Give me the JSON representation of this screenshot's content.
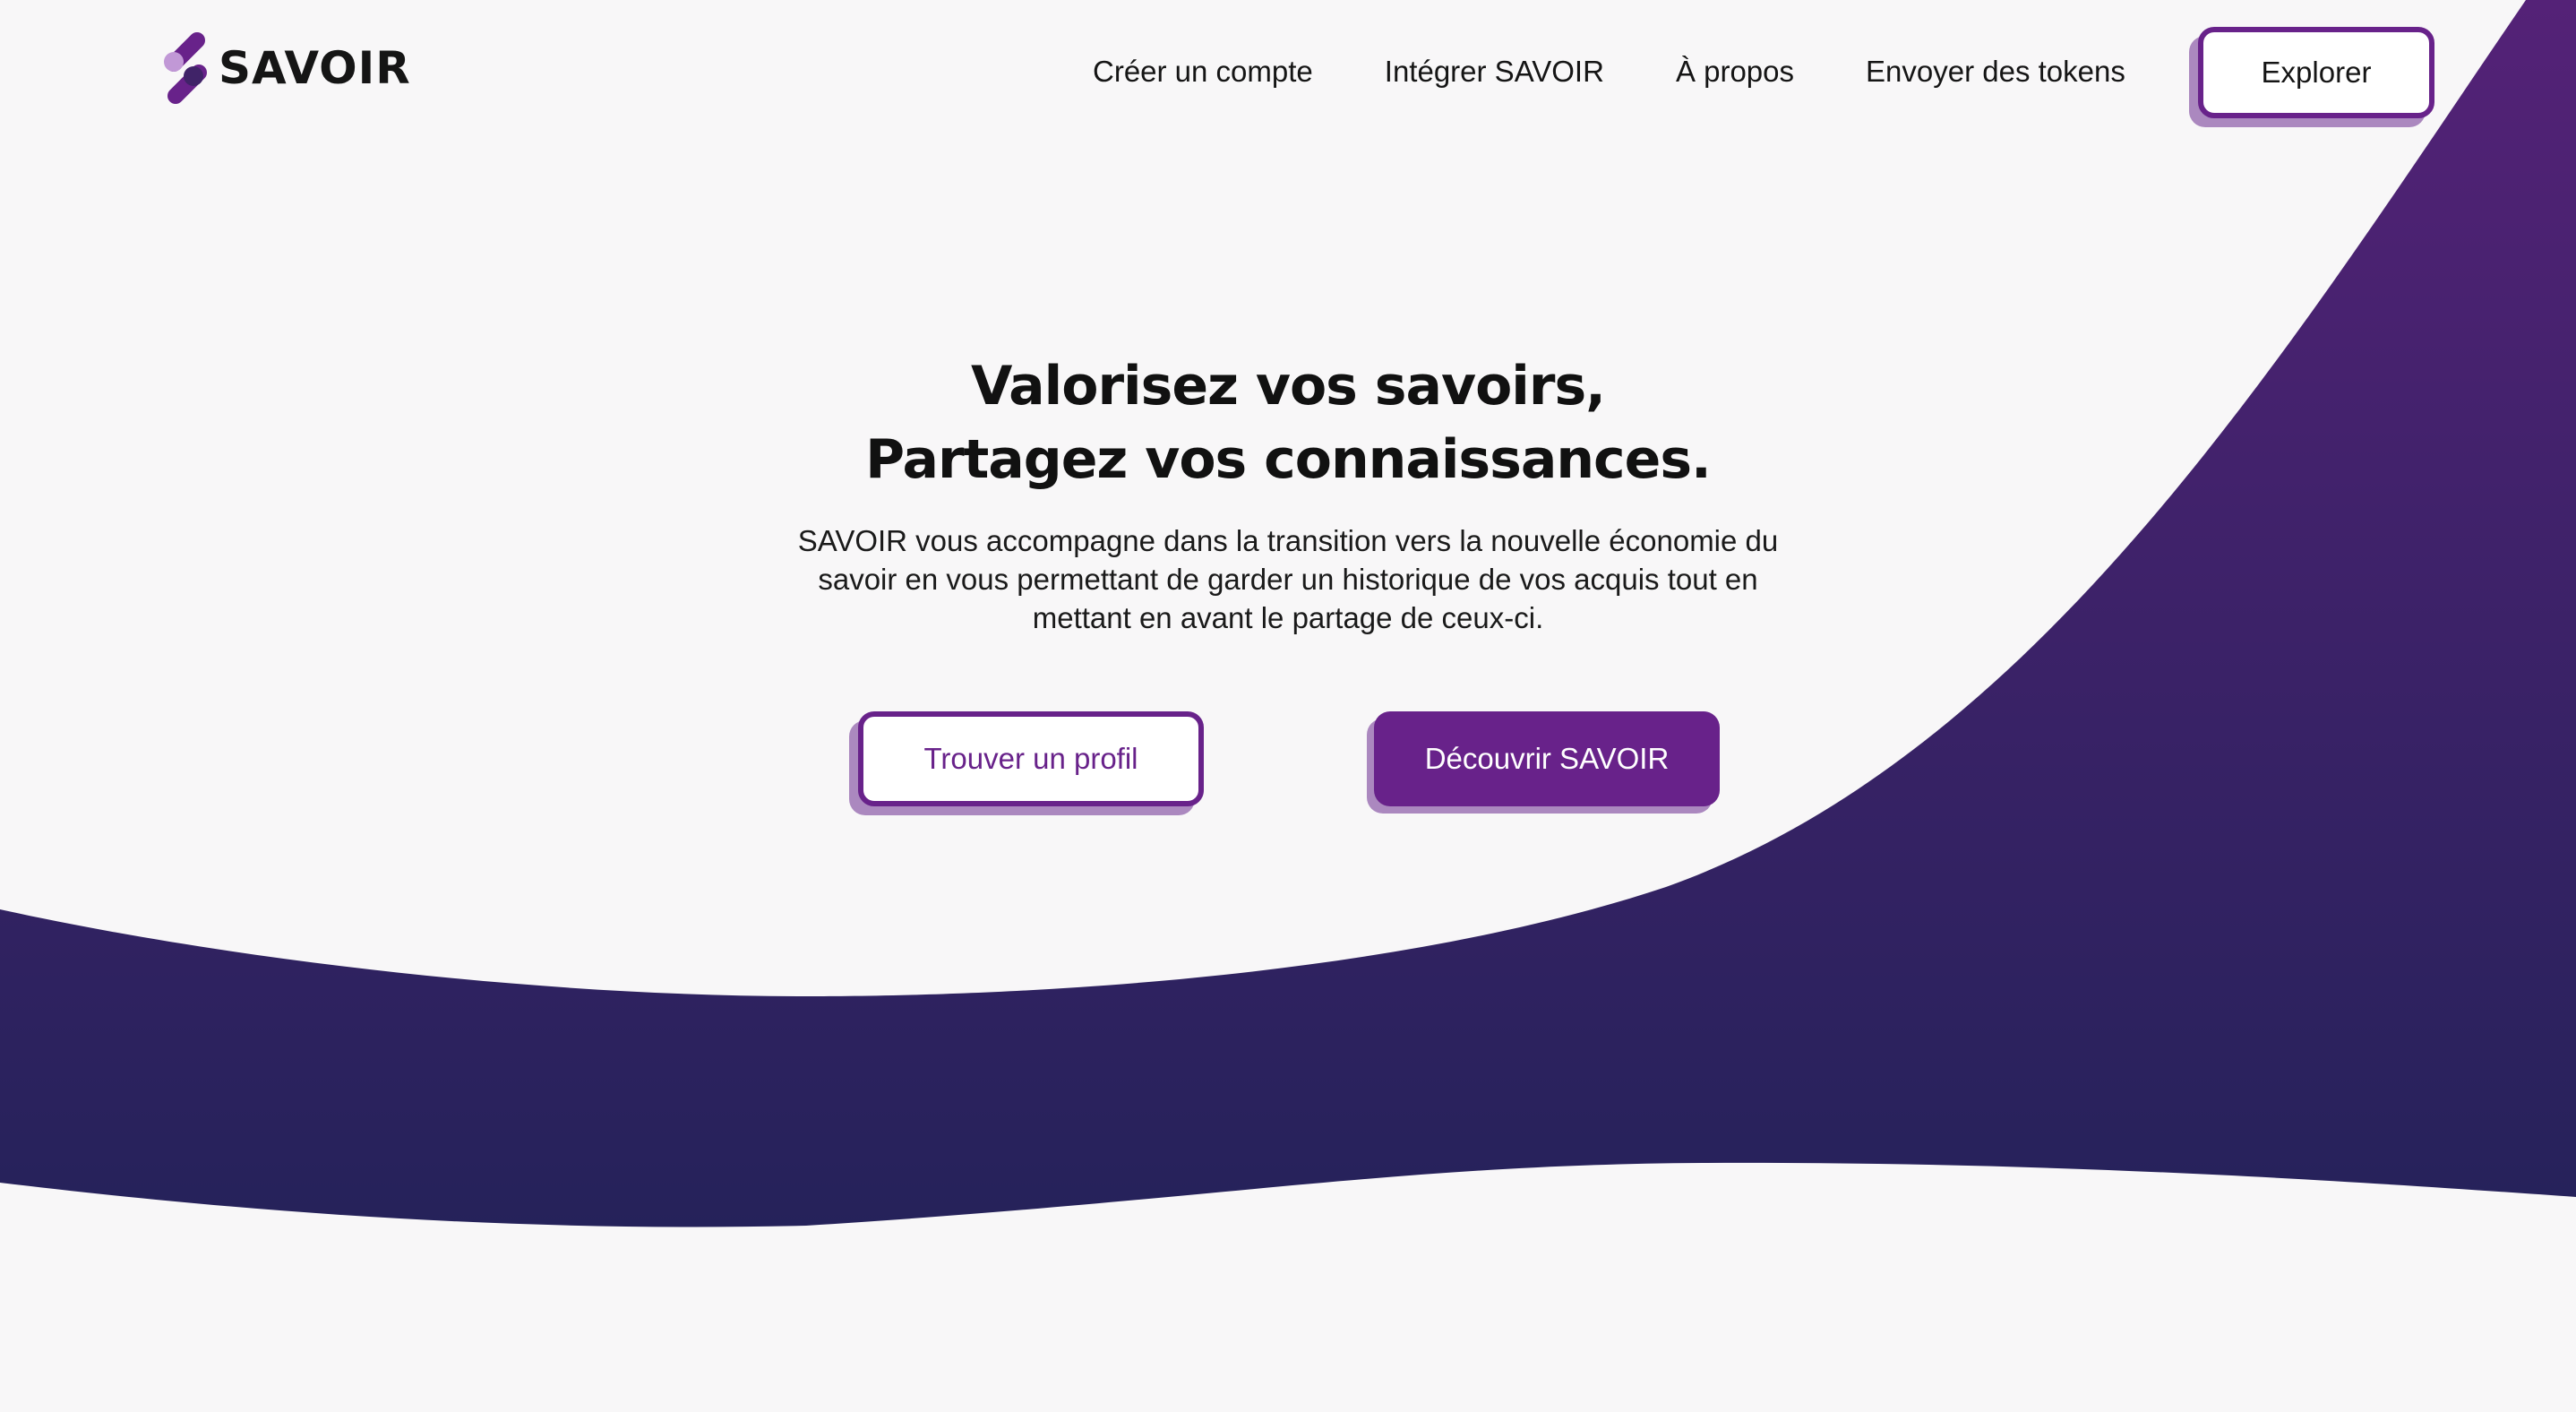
{
  "brand": {
    "name": "SAVOIR",
    "colors": {
      "primary": "#68228a",
      "primary_light": "#ab88bf",
      "wave_top": "#542277",
      "wave_bottom": "#25225a",
      "background": "#f8f7f8"
    }
  },
  "nav": {
    "items": [
      {
        "label": "Créer un compte"
      },
      {
        "label": "Intégrer SAVOIR"
      },
      {
        "label": "À propos"
      },
      {
        "label": "Envoyer des tokens"
      }
    ],
    "explore_label": "Explorer"
  },
  "hero": {
    "title_line1": "Valorisez vos savoirs,",
    "title_line2": "Partagez vos connaissances.",
    "description": "SAVOIR vous accompagne dans la transition vers la nouvelle économie du savoir en vous permettant de garder un historique de vos acquis tout en mettant en avant le partage de ceux-ci.",
    "find_profile_label": "Trouver un profil",
    "discover_label": "Découvrir SAVOIR"
  }
}
